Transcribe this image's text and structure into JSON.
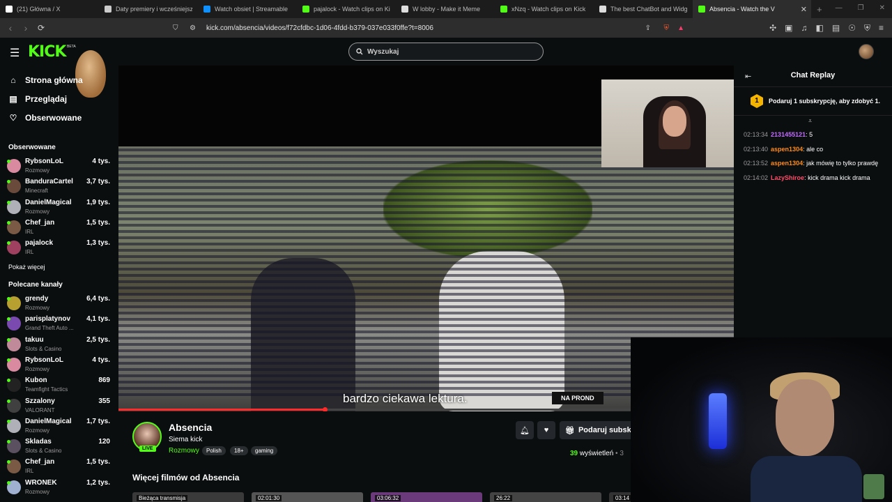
{
  "browser": {
    "tabs": [
      {
        "title": "(21) Główna / X",
        "color": "#ffffff"
      },
      {
        "title": "Daty premiery i wcześniejszy d",
        "color": "#cccccc"
      },
      {
        "title": "Watch obsiet | Streamable",
        "color": "#0f90fa"
      },
      {
        "title": "pajalock - Watch clips on Kick",
        "color": "#53fc18"
      },
      {
        "title": "W lobby - Make it Meme",
        "color": "#dddddd"
      },
      {
        "title": "xNzq - Watch clips on Kick",
        "color": "#53fc18"
      },
      {
        "title": "The best ChatBot and Widgets",
        "color": "#dddddd"
      },
      {
        "title": "Absencia - Watch the V",
        "color": "#53fc18"
      }
    ],
    "url": "kick.com/absencia/videos/f72cfdbc-1d06-4fdd-b379-037e033f0ffe?t=8006"
  },
  "header": {
    "logo": "KICK",
    "logo_badge": "BETA",
    "search_placeholder": "Wyszukaj"
  },
  "sidebar": {
    "nav": [
      {
        "label": "Strona główna",
        "icon": "home-icon"
      },
      {
        "label": "Przeglądaj",
        "icon": "browse-icon"
      },
      {
        "label": "Obserwowane",
        "icon": "heart-icon"
      }
    ],
    "followed_title": "Obserwowane",
    "followed": [
      {
        "name": "RybsonLoL",
        "category": "Rozmowy",
        "viewers": "4 tys.",
        "color": "#d98aa0"
      },
      {
        "name": "BanduraCartel",
        "category": "Minecraft",
        "viewers": "3,7 tys.",
        "color": "#6a4a3a"
      },
      {
        "name": "DanielMagical",
        "category": "Rozmowy",
        "viewers": "1,9 tys.",
        "color": "#b0b0b8"
      },
      {
        "name": "Chef_jan",
        "category": "IRL",
        "viewers": "1,5 tys.",
        "color": "#7a5a44"
      },
      {
        "name": "pajalock",
        "category": "IRL",
        "viewers": "1,3 tys.",
        "color": "#a04060"
      }
    ],
    "show_more": "Pokaż więcej",
    "recommended_title": "Polecane kanały",
    "recommended": [
      {
        "name": "grendy",
        "category": "Rozmowy",
        "viewers": "6,4 tys.",
        "color": "#b8a030"
      },
      {
        "name": "parisplatynov",
        "category": "Grand Theft Auto ...",
        "viewers": "4,1 tys.",
        "color": "#7a4ab0"
      },
      {
        "name": "takuu",
        "category": "Slots & Casino",
        "viewers": "2,5 tys.",
        "color": "#c08a9a"
      },
      {
        "name": "RybsonLoL",
        "category": "Rozmowy",
        "viewers": "4 tys.",
        "color": "#d98aa0"
      },
      {
        "name": "Kubon",
        "category": "Teamfight Tactics",
        "viewers": "869",
        "color": "#222222"
      },
      {
        "name": "Szzalony",
        "category": "VALORANT",
        "viewers": "355",
        "color": "#404040"
      },
      {
        "name": "DanielMagical",
        "category": "Rozmowy",
        "viewers": "1,7 tys.",
        "color": "#b0b0b8"
      },
      {
        "name": "Skladas",
        "category": "Slots & Casino",
        "viewers": "120",
        "color": "#5a5060"
      },
      {
        "name": "Chef_jan",
        "category": "IRL",
        "viewers": "1,5 tys.",
        "color": "#7a5a44"
      },
      {
        "name": "WRONEK",
        "category": "Rozmowy",
        "viewers": "1,2 tys.",
        "color": "#a0b0d0"
      }
    ]
  },
  "video": {
    "subtitle": "bardzo ciekawa lektura.",
    "overlay_label": "NA PROND",
    "progress": 0.336
  },
  "channel": {
    "name": "Absencia",
    "live": "LIVE",
    "stream_title": "Siema kick",
    "category": "Rozmowy",
    "tags": [
      "Polish",
      "18+",
      "gaming"
    ],
    "gift_label": "Podaruj subskr",
    "views_count": "39",
    "views_label": "wyświetleń",
    "more_videos_title": "Więcej filmów od Absencia",
    "thumbnails": [
      "Bieżąca transmisja",
      "02:01:30",
      "03:06:32",
      "26:22",
      "03:14"
    ]
  },
  "chat": {
    "title": "Chat Replay",
    "gift_rank": "1",
    "gift_text": "Podaruj 1 subskrypcję, aby zdobyć 1.",
    "messages": [
      {
        "time": "02:13:34",
        "user": "2131455121",
        "text": ": 5",
        "color": "#c26bff"
      },
      {
        "time": "02:13:40",
        "user": "aspen1304",
        "text": ": ale co",
        "color": "#ff8c1a"
      },
      {
        "time": "02:13:52",
        "user": "aspen1304",
        "text": ": jak mówię to tylko prawdę",
        "color": "#ff8c1a"
      },
      {
        "time": "02:14:02",
        "user": "LazyShiroe",
        "text": ": kick drama kick drama",
        "color": "#ff4d6a"
      }
    ]
  }
}
